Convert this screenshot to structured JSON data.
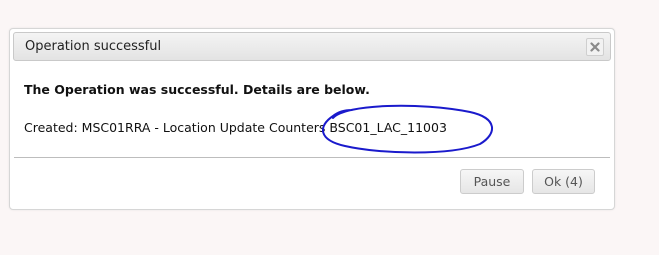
{
  "dialog": {
    "title": "Operation successful",
    "close_icon": "close-x-icon",
    "heading": "The Operation was successful. Details are below.",
    "detail": "Created: MSC01RRA - Location Update Counters BSC01_LAC_11003",
    "buttons": {
      "pause_label": "Pause",
      "ok_label": "Ok (4)"
    }
  },
  "colors": {
    "annotation": "#1a1acc",
    "background": "#fbf6f6"
  }
}
